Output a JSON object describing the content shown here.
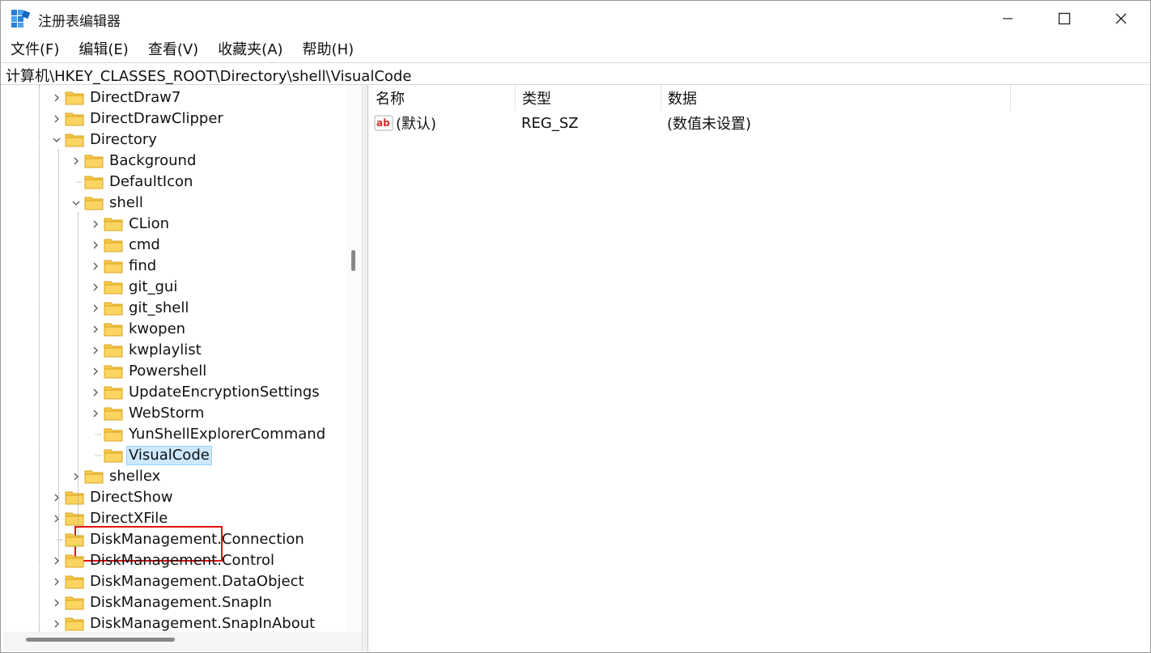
{
  "window": {
    "title": "注册表编辑器",
    "controls": {
      "minimize": "minimize-icon",
      "maximize": "maximize-icon",
      "close": "close-icon"
    }
  },
  "menubar": {
    "items": [
      "文件(F)",
      "编辑(E)",
      "查看(V)",
      "收藏夹(A)",
      "帮助(H)"
    ]
  },
  "address": {
    "path": "计算机\\HKEY_CLASSES_ROOT\\Directory\\shell\\VisualCode"
  },
  "tree": {
    "items": [
      {
        "label": "DirectDraw7",
        "depth": 0,
        "expander": "collapsed"
      },
      {
        "label": "DirectDrawClipper",
        "depth": 0,
        "expander": "collapsed"
      },
      {
        "label": "Directory",
        "depth": 0,
        "expander": "expanded"
      },
      {
        "label": "Background",
        "depth": 1,
        "expander": "collapsed"
      },
      {
        "label": "DefaultIcon",
        "depth": 1,
        "expander": "none"
      },
      {
        "label": "shell",
        "depth": 1,
        "expander": "expanded"
      },
      {
        "label": "CLion",
        "depth": 2,
        "expander": "collapsed"
      },
      {
        "label": "cmd",
        "depth": 2,
        "expander": "collapsed"
      },
      {
        "label": "find",
        "depth": 2,
        "expander": "collapsed"
      },
      {
        "label": "git_gui",
        "depth": 2,
        "expander": "collapsed"
      },
      {
        "label": "git_shell",
        "depth": 2,
        "expander": "collapsed"
      },
      {
        "label": "kwopen",
        "depth": 2,
        "expander": "collapsed"
      },
      {
        "label": "kwplaylist",
        "depth": 2,
        "expander": "collapsed"
      },
      {
        "label": "Powershell",
        "depth": 2,
        "expander": "collapsed"
      },
      {
        "label": "UpdateEncryptionSettings",
        "depth": 2,
        "expander": "collapsed"
      },
      {
        "label": "WebStorm",
        "depth": 2,
        "expander": "collapsed"
      },
      {
        "label": "YunShellExplorerCommand",
        "depth": 2,
        "expander": "none"
      },
      {
        "label": "VisualCode",
        "depth": 2,
        "expander": "none",
        "selected": true
      },
      {
        "label": "shellex",
        "depth": 1,
        "expander": "collapsed"
      },
      {
        "label": "DirectShow",
        "depth": 0,
        "expander": "collapsed"
      },
      {
        "label": "DirectXFile",
        "depth": 0,
        "expander": "collapsed"
      },
      {
        "label": "DiskManagement.Connection",
        "depth": 0,
        "expander": "none"
      },
      {
        "label": "DiskManagement.Control",
        "depth": 0,
        "expander": "collapsed"
      },
      {
        "label": "DiskManagement.DataObject",
        "depth": 0,
        "expander": "collapsed"
      },
      {
        "label": "DiskManagement.SnapIn",
        "depth": 0,
        "expander": "collapsed"
      },
      {
        "label": "DiskManagement.SnapInAbout",
        "depth": 0,
        "expander": "collapsed"
      }
    ]
  },
  "values": {
    "columns": [
      "名称",
      "类型",
      "数据"
    ],
    "rows": [
      {
        "name": "(默认)",
        "type": "REG_SZ",
        "data": "(数值未设置)",
        "icon": "string-value-icon"
      }
    ]
  },
  "colors": {
    "selection_bg": "#cce8ff",
    "selection_border": "#99d1ff",
    "highlight_box": "#e01010",
    "folder": "#f8c94a"
  }
}
